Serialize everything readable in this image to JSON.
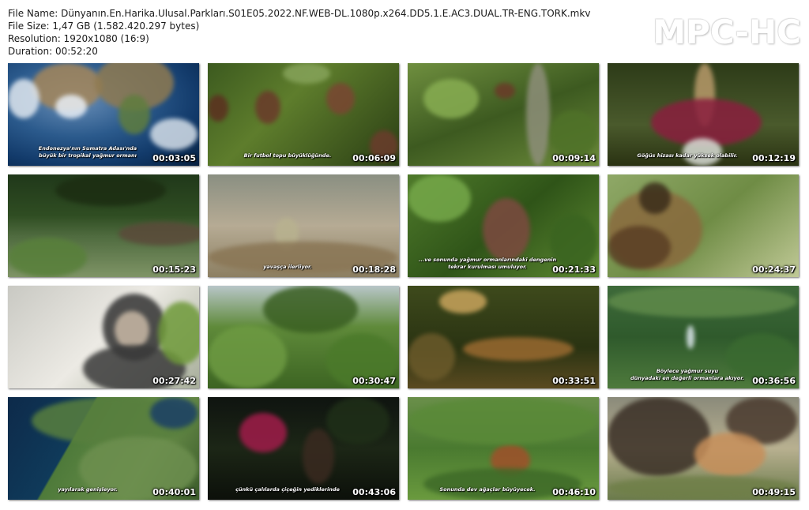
{
  "header": {
    "file_name": "File Name: Dünyanın.En.Harika.Ulusal.Parkları.S01E05.2022.NF.WEB-DL.1080p.x264.DD5.1.E.AC3.DUAL.TR-ENG.TORK.mkv",
    "file_size": "File Size: 1,47 GB (1.582.420.297 bytes)",
    "resolution": "Resolution: 1920x1080 (16:9)",
    "duration": "Duration: 00:52:20"
  },
  "logo": "MPC-HC",
  "thumbnails": [
    {
      "time": "00:03:05",
      "subtitle": "Endonezya'nın Sumatra Adası'nda\nbüyük bir tropikal yağmur ormanı",
      "scene": "earth"
    },
    {
      "time": "00:06:09",
      "subtitle": "Bir futbol topu büyüklüğünde.",
      "scene": "fruit"
    },
    {
      "time": "00:09:14",
      "subtitle": "",
      "scene": "tree"
    },
    {
      "time": "00:12:19",
      "subtitle": "Göğüs hizası kadar yüksek olabilir.",
      "scene": "flower"
    },
    {
      "time": "00:15:23",
      "subtitle": "",
      "scene": "river"
    },
    {
      "time": "00:18:28",
      "subtitle": "yavaşça ilerliyor.",
      "scene": "mud"
    },
    {
      "time": "00:21:33",
      "subtitle": "...ve sonunda yağmur ormanlarındaki dengenin\ntekrar kurulması umuluyor.",
      "scene": "leaves"
    },
    {
      "time": "00:24:37",
      "subtitle": "",
      "scene": "frog"
    },
    {
      "time": "00:27:42",
      "subtitle": "",
      "scene": "monkey"
    },
    {
      "time": "00:30:47",
      "subtitle": "",
      "scene": "canopy"
    },
    {
      "time": "00:33:51",
      "subtitle": "",
      "scene": "slug"
    },
    {
      "time": "00:36:56",
      "subtitle": "Böylece yağmur suyu\ndünyadaki en değerli ormanlara akıyor.",
      "scene": "hills"
    },
    {
      "time": "00:40:01",
      "subtitle": "yayılarak genişleyor.",
      "scene": "island"
    },
    {
      "time": "00:43:06",
      "subtitle": "çünkü çalılarda çiçeğin yediklerinde",
      "scene": "dark"
    },
    {
      "time": "00:46:10",
      "subtitle": "Sonunda dev ağaçlar büyüyecek.",
      "scene": "orangutan"
    },
    {
      "time": "00:49:15",
      "subtitle": "",
      "scene": "bison"
    }
  ]
}
